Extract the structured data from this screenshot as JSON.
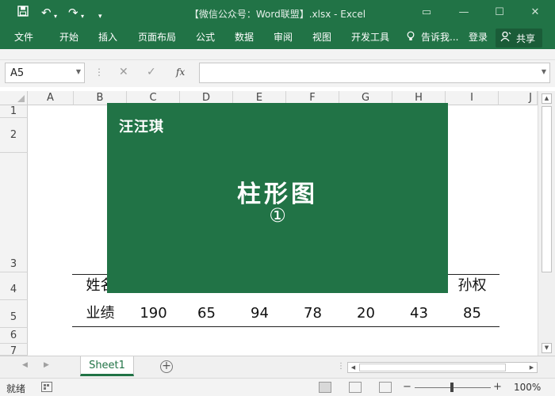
{
  "quick_access": {
    "save_icon": "save-icon",
    "undo_icon": "undo-icon",
    "redo_icon": "redo-icon",
    "customize_icon": "customize-icon"
  },
  "window": {
    "title": "【微信公众号：Word联盟】.xlsx - Excel"
  },
  "ribbon": {
    "tabs": [
      "文件",
      "开始",
      "插入",
      "页面布局",
      "公式",
      "数据",
      "审阅",
      "视图",
      "开发工具"
    ],
    "tell_me": "告诉我...",
    "login": "登录",
    "share": "共享"
  },
  "formula_bar": {
    "name_box": "A5",
    "fx_label": "fx",
    "content": ""
  },
  "columns": [
    "A",
    "B",
    "C",
    "D",
    "E",
    "F",
    "G",
    "H",
    "I",
    "J"
  ],
  "rows": [
    "1",
    "2",
    "3",
    "4",
    "5",
    "6",
    "7"
  ],
  "table": {
    "row4_label": "姓名",
    "row4_last": "孙权",
    "row5_label": "业绩",
    "row5_values": [
      "190",
      "65",
      "94",
      "78",
      "20",
      "43",
      "85"
    ]
  },
  "overlay": {
    "brand": "汪汪琪",
    "title": "柱形图",
    "number": "①"
  },
  "sheets": {
    "tabs": [
      "Sheet1"
    ]
  },
  "status": {
    "ready": "就绪",
    "zoom": "100%"
  },
  "colors": {
    "accent": "#217346"
  }
}
